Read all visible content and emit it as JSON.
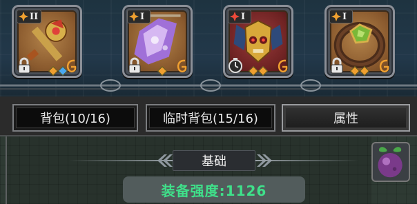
{
  "equipment": [
    {
      "rank": "II",
      "locked": true,
      "frame": "gold",
      "gems": [
        "orange",
        "blue"
      ],
      "icon": "golden-mace"
    },
    {
      "rank": "I",
      "locked": true,
      "frame": "gold",
      "gems": [
        "orange"
      ],
      "icon": "purple-banner"
    },
    {
      "rank": "I",
      "locked": false,
      "frame": "red",
      "gems": [
        "orange",
        "orange"
      ],
      "icon": "golden-skull-pauldron"
    },
    {
      "rank": "I",
      "locked": true,
      "frame": "gold",
      "gems": [
        "orange",
        "orange"
      ],
      "icon": "emerald-ring"
    }
  ],
  "tabs": [
    {
      "label": "背包(10/16)",
      "active": false
    },
    {
      "label": "临时背包(15/16)",
      "active": false
    },
    {
      "label": "属性",
      "active": true
    }
  ],
  "section": {
    "title": "基础"
  },
  "power": {
    "text": "装备强度:1126"
  },
  "side_button": {
    "icon": "purple-fruit-icon"
  },
  "colors": {
    "power_text": "#3fe08a",
    "gold_frame": "#8a5a2e",
    "red_frame": "#6f2323"
  }
}
